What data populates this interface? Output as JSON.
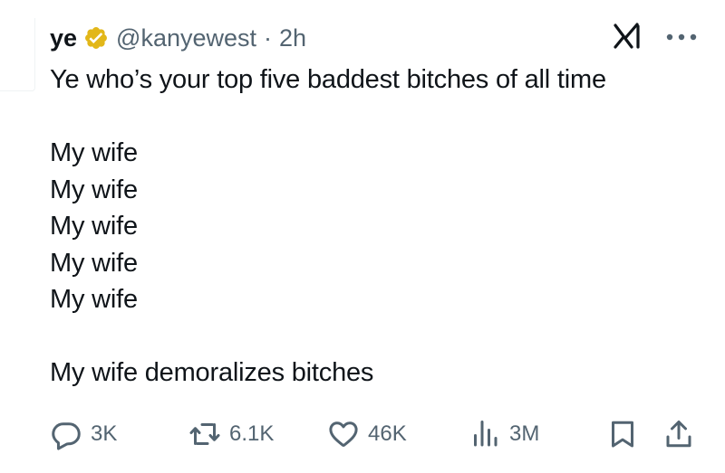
{
  "header": {
    "name": "ye",
    "handle": "@kanyewest",
    "separator": "·",
    "time": "2h"
  },
  "icons": {
    "verified": "verified-badge-icon",
    "grok": "grok-icon",
    "more": "more-options-icon",
    "reply": "reply-icon",
    "retweet": "retweet-icon",
    "like": "like-icon",
    "views": "views-icon",
    "bookmark": "bookmark-icon",
    "share": "share-icon"
  },
  "colors": {
    "verified": "#e2b719",
    "text": "#0f1419",
    "secondary": "#536471"
  },
  "tweet": {
    "lines": [
      "Ye who’s your top five baddest bitches of all time",
      "",
      "My wife",
      "My wife",
      "My wife",
      "My wife",
      "My wife",
      "",
      "My wife demoralizes bitches"
    ]
  },
  "actions": {
    "replies": "3K",
    "reposts": "6.1K",
    "likes": "46K",
    "views": "3M"
  }
}
